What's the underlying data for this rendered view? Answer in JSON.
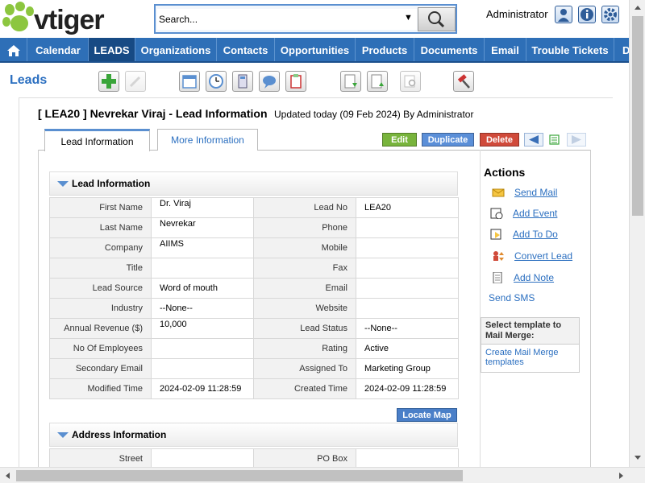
{
  "header": {
    "logo_text": "vtiger",
    "search_placeholder": "Search...",
    "user_name": "Administrator",
    "icons": [
      "user-icon",
      "info-icon",
      "settings-icon"
    ]
  },
  "nav": {
    "items": [
      "Calendar",
      "LEADS",
      "Organizations",
      "Contacts",
      "Opportunities",
      "Products",
      "Documents",
      "Email",
      "Trouble Tickets",
      "D"
    ],
    "active": "LEADS"
  },
  "toolbar": {
    "module_title": "Leads"
  },
  "record": {
    "title": "[ LEA20 ] Nevrekar Viraj - Lead Information",
    "updated": "Updated today (09 Feb 2024) By Administrator"
  },
  "tabs": {
    "lead_info": "Lead Information",
    "more_info": "More Information"
  },
  "buttons": {
    "edit": "Edit",
    "duplicate": "Duplicate",
    "delete": "Delete",
    "locate_map": "Locate Map"
  },
  "lead_block": {
    "title": "Lead Information",
    "rows": [
      {
        "l1": "First Name",
        "v1": "Dr.   Viraj",
        "l2": "Lead No",
        "v2": "LEA20"
      },
      {
        "l1": "Last Name",
        "v1": "Nevrekar",
        "l2": "Phone",
        "v2": ""
      },
      {
        "l1": "Company",
        "v1": "AIIMS",
        "l2": "Mobile",
        "v2": ""
      },
      {
        "l1": "Title",
        "v1": "",
        "l2": "Fax",
        "v2": ""
      },
      {
        "l1": "Lead Source",
        "v1": "Word of mouth",
        "l2": "Email",
        "v2": ""
      },
      {
        "l1": "Industry",
        "v1": "--None--",
        "l2": "Website",
        "v2": ""
      },
      {
        "l1": "Annual Revenue ($)",
        "v1": "10,000",
        "l2": "Lead Status",
        "v2": "--None--"
      },
      {
        "l1": "No Of Employees",
        "v1": "",
        "l2": "Rating",
        "v2": "Active"
      },
      {
        "l1": "Secondary Email",
        "v1": "",
        "l2": "Assigned To",
        "v2": "Marketing Group"
      },
      {
        "l1": "Modified Time",
        "v1": "2024-02-09 11:28:59",
        "l2": "Created Time",
        "v2": "2024-02-09 11:28:59"
      }
    ]
  },
  "address_block": {
    "title": "Address Information",
    "rows": [
      {
        "l1": "Street",
        "v1": "",
        "l2": "PO Box",
        "v2": ""
      }
    ]
  },
  "actions": {
    "title": "Actions",
    "send_mail": "Send Mail",
    "add_event": "Add Event",
    "add_todo": "Add To Do",
    "convert_lead": "Convert Lead",
    "add_note": "Add Note",
    "send_sms": "Send SMS",
    "mail_merge_title": "Select template to Mail Merge:",
    "mail_merge_link": "Create Mail Merge templates"
  }
}
